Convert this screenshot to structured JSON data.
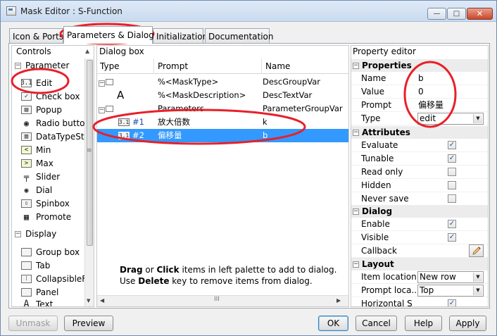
{
  "window": {
    "title": "Mask Editor : S-Function",
    "minimize": "—",
    "maximize": "□",
    "close": "✕"
  },
  "tabs": [
    {
      "label": "Icon & Ports"
    },
    {
      "label": "Parameters & Dialog",
      "active": true
    },
    {
      "label": "Initialization"
    },
    {
      "label": "Documentation"
    }
  ],
  "controls": {
    "header": "Controls",
    "parameter_group": "Parameter",
    "parameter_items": [
      {
        "label": "Edit",
        "icon": "edit-icon",
        "glyph": "3.1"
      },
      {
        "label": "Check box",
        "icon": "checkbox-icon",
        "glyph": "✓"
      },
      {
        "label": "Popup",
        "icon": "popup-icon",
        "glyph": "▤"
      },
      {
        "label": "Radio butto",
        "icon": "radio-button-icon",
        "glyph": "◉"
      },
      {
        "label": "DataTypeStr",
        "icon": "datatype-icon",
        "glyph": "▥"
      },
      {
        "label": "Min",
        "icon": "min-icon",
        "glyph": "<"
      },
      {
        "label": "Max",
        "icon": "max-icon",
        "glyph": ">"
      },
      {
        "label": "Slider",
        "icon": "slider-icon",
        "glyph": "╤"
      },
      {
        "label": "Dial",
        "icon": "dial-icon",
        "glyph": "✺"
      },
      {
        "label": "Spinbox",
        "icon": "spinbox-icon",
        "glyph": "⇳"
      },
      {
        "label": "Promote",
        "icon": "promote-icon",
        "glyph": "▦"
      }
    ],
    "display_group": "Display",
    "display_items": [
      {
        "label": "Group box",
        "icon": "group-box-icon",
        "glyph": " "
      },
      {
        "label": "Tab",
        "icon": "tab-icon",
        "glyph": " "
      },
      {
        "label": "CollapsibleF",
        "icon": "collapsible-icon",
        "glyph": "⁝"
      },
      {
        "label": "Panel",
        "icon": "panel-icon",
        "glyph": " "
      },
      {
        "label": "Text",
        "icon": "text-icon",
        "glyph": "A"
      }
    ]
  },
  "dialog_box": {
    "header": "Dialog box",
    "columns": {
      "type": "Type",
      "prompt": "Prompt",
      "name": "Name"
    },
    "rows": [
      {
        "type": "",
        "prompt": "%<MaskType>",
        "name": "DescGroupVar"
      },
      {
        "type": "A",
        "prompt": "%<MaskDescription>",
        "name": "DescTextVar"
      },
      {
        "type": "",
        "prompt": "Parameters",
        "name": "ParameterGroupVar"
      },
      {
        "type": "#1",
        "prompt": "放大倍数",
        "name": "k"
      },
      {
        "type": "#2",
        "prompt": "偏移量",
        "name": "b",
        "selected": true
      }
    ],
    "edit_glyph": "3.1",
    "hint_line1_bold1": "Drag",
    "hint_line1_mid": " or ",
    "hint_line1_bold2": "Click",
    "hint_line1_rest": " items in left palette to add to dialog.",
    "hint_line2_pre": "Use ",
    "hint_line2_bold": "Delete",
    "hint_line2_rest": " key to remove items from dialog.",
    "scroll_grip": "III"
  },
  "property_editor": {
    "header": "Property editor",
    "sections": {
      "properties": "Properties",
      "attributes": "Attributes",
      "dialog": "Dialog",
      "layout": "Layout"
    },
    "properties": {
      "name_label": "Name",
      "name_value": "b",
      "value_label": "Value",
      "value_value": "0",
      "prompt_label": "Prompt",
      "prompt_value": "偏移量",
      "type_label": "Type",
      "type_value": "edit"
    },
    "attributes": [
      {
        "label": "Evaluate",
        "checked": true
      },
      {
        "label": "Tunable",
        "checked": true
      },
      {
        "label": "Read only",
        "checked": false
      },
      {
        "label": "Hidden",
        "checked": false
      },
      {
        "label": "Never save",
        "checked": false
      }
    ],
    "dialog": [
      {
        "label": "Enable",
        "checked": true
      },
      {
        "label": "Visible",
        "checked": true
      }
    ],
    "callback_label": "Callback",
    "layout": {
      "item_location_label": "Item location",
      "item_location_value": "New row",
      "prompt_location_label": "Prompt loca...",
      "prompt_location_value": "Top",
      "horizontal_label": "Horizontal S",
      "horizontal_checked": true
    }
  },
  "buttons": {
    "unmask": "Unmask",
    "preview": "Preview",
    "ok": "OK",
    "cancel": "Cancel",
    "help": "Help",
    "apply": "Apply"
  },
  "colors": {
    "selection": "#3399ff",
    "annotation": "#e8202a"
  }
}
